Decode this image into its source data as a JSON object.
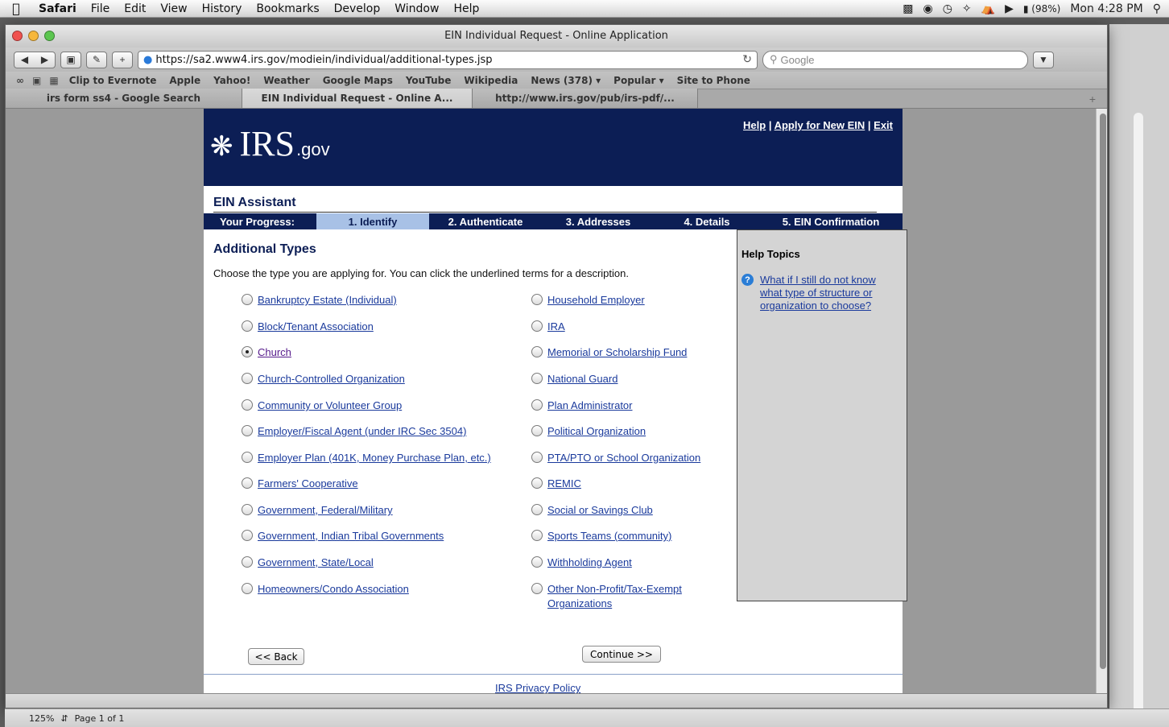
{
  "menubar": {
    "apple": "",
    "app": "Safari",
    "items": [
      "File",
      "Edit",
      "View",
      "History",
      "Bookmarks",
      "Develop",
      "Window",
      "Help"
    ],
    "battery": "(98%)",
    "clock": "Mon 4:28 PM"
  },
  "window": {
    "title": "EIN Individual Request - Online Application",
    "url": "https://sa2.www4.irs.gov/modiein/individual/additional-types.jsp",
    "search_placeholder": "Google"
  },
  "bookmarks": [
    "Clip to Evernote",
    "Apple",
    "Yahoo!",
    "Weather",
    "Google Maps",
    "YouTube",
    "Wikipedia",
    "News (378) ▾",
    "Popular ▾",
    "Site to Phone"
  ],
  "tabs": [
    {
      "label": "irs form ss4 - Google Search"
    },
    {
      "label": "EIN Individual Request - Online A..."
    },
    {
      "label": "http://www.irs.gov/pub/irs-pdf/..."
    }
  ],
  "header": {
    "logo_irs": "IRS",
    "logo_gov": ".gov",
    "link_help": "Help",
    "link_apply": "Apply for New EIN",
    "link_exit": "Exit",
    "sep": " | "
  },
  "assistant_title": "EIN Assistant",
  "progress": {
    "label": "Your Progress:",
    "steps": [
      "1. Identify",
      "2. Authenticate",
      "3. Addresses",
      "4. Details",
      "5. EIN Confirmation"
    ],
    "current": "1. Identify"
  },
  "section_title": "Additional Types",
  "instructions": "Choose the type you are applying for. You can click the underlined terms for a description.",
  "options_left": [
    "Bankruptcy Estate (Individual)",
    "Block/Tenant Association",
    "Church",
    "Church-Controlled Organization",
    "Community or Volunteer Group",
    "Employer/Fiscal Agent (under IRC Sec 3504)",
    "Employer Plan (401K, Money Purchase Plan, etc.)",
    "Farmers' Cooperative",
    "Government, Federal/Military",
    "Government, Indian Tribal Governments",
    "Government, State/Local",
    "Homeowners/Condo Association"
  ],
  "options_right": [
    "Household Employer",
    "IRA",
    "Memorial or Scholarship Fund",
    "National Guard",
    "Plan Administrator",
    "Political Organization",
    "PTA/PTO or School Organization",
    "REMIC",
    "Social or Savings Club",
    "Sports Teams (community)",
    "Withholding Agent",
    "Other Non-Profit/Tax-Exempt Organizations"
  ],
  "selected": "Church",
  "help": {
    "title": "Help Topics",
    "link": "What if I still do not know what type of structure or organization to choose?"
  },
  "buttons": {
    "back": "<< Back",
    "continue": "Continue >>"
  },
  "footer": {
    "privacy": "IRS Privacy Policy"
  },
  "statusbar": {
    "zoom": "125%",
    "page": "Page 1 of 1"
  }
}
